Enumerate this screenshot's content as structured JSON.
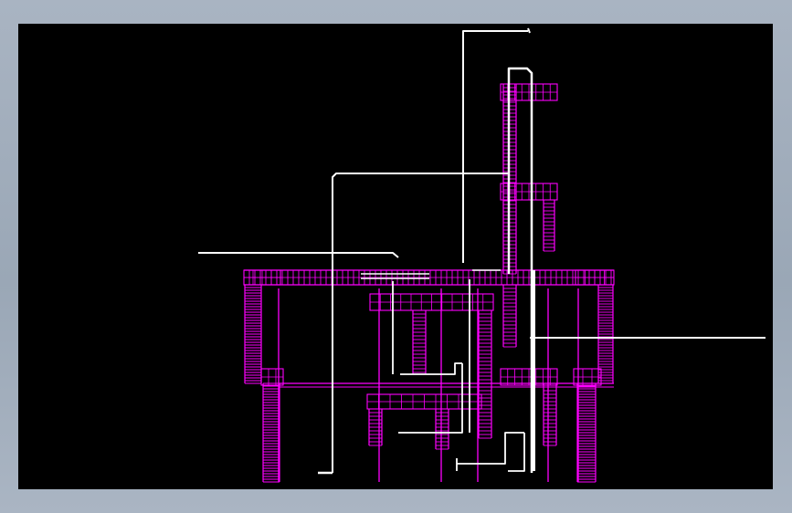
{
  "viewport": {
    "background": "#000000",
    "frame_color": "#a3afbe"
  },
  "colors": {
    "structure": "#ff00ff",
    "pipe": "#ffffff"
  }
}
